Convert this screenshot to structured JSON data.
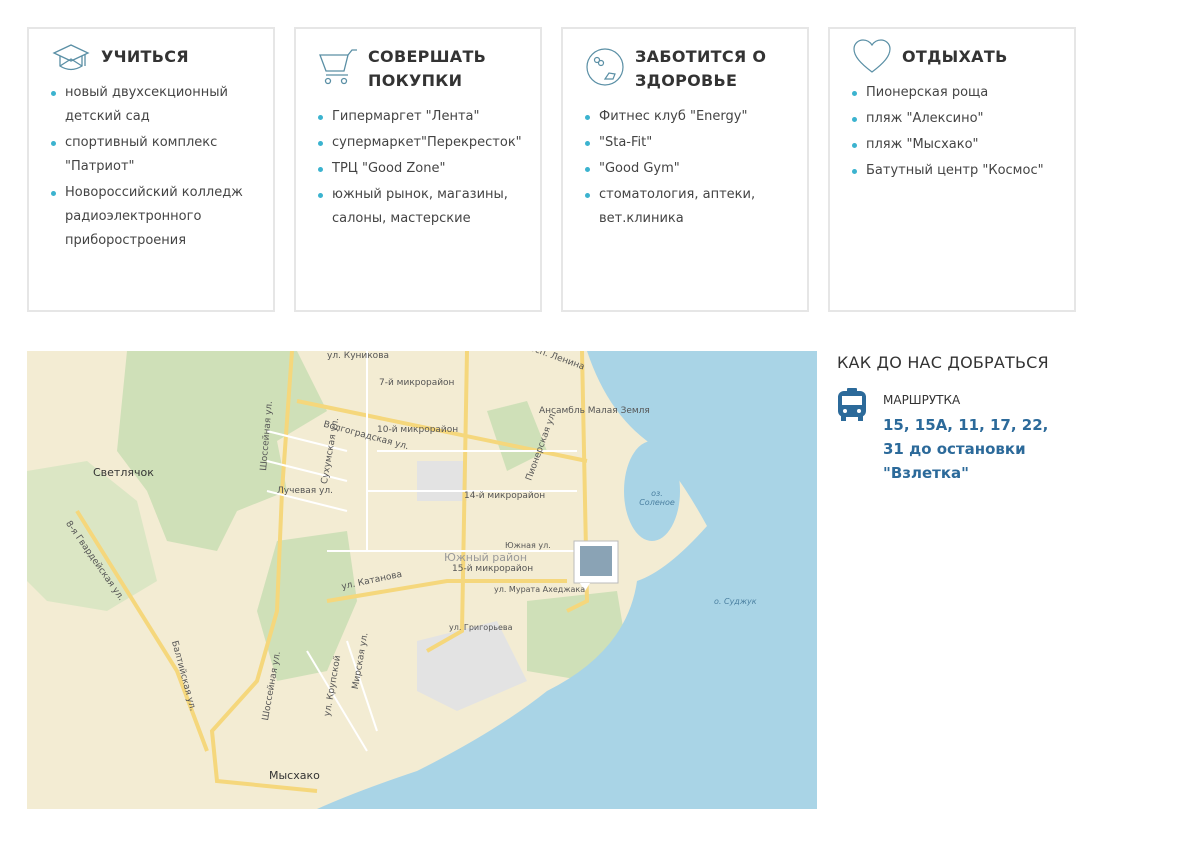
{
  "cards": [
    {
      "title": "УЧИТЬСЯ",
      "icon": "graduation-cap-icon",
      "items": [
        "новый двухсекционный детский сад",
        "спортивный комплекс \"Патриот\"",
        "Новороссийский колледж радиоэлектронного приборостроения"
      ]
    },
    {
      "title": "СОВЕРШАТЬ ПОКУПКИ",
      "icon": "shopping-cart-icon",
      "items": [
        "Гипермаргет \"Лента\"",
        "супермаркет\"Перекресток\"",
        "ТРЦ \"Good Zone\"",
        "южный рынок, магазины, салоны, мастерские"
      ]
    },
    {
      "title": "ЗАБОТИТСЯ О ЗДОРОВЬЕ",
      "icon": "health-icon",
      "items": [
        "Фитнес клуб \"Energy\"",
        "\"Sta-Fit\"",
        "\"Good Gym\"",
        "стоматология, аптеки, вет.клиника"
      ]
    },
    {
      "title": "ОТДЫХАТЬ",
      "icon": "heart-icon",
      "items": [
        "Пионерская роща",
        "пляж \"Алексино\"",
        "пляж \"Мысхако\"",
        "Батутный центр \"Космос\""
      ]
    }
  ],
  "map": {
    "labels": {
      "kunikova": "ул. Куникова",
      "lenina": "просп. Ленина",
      "mr7": "7-й микрорайон",
      "mr10": "10-й микрорайон",
      "volgograd": "Волгоградская ул.",
      "ansambl": "Ансамбль Малая Земля",
      "svetlyachok": "Светлячок",
      "shosseinaya1": "Шоссейная ул.",
      "sukhumi": "Сухумская ул.",
      "luchevaya": "Лучевая ул.",
      "pionerskaya": "Пионерская ул.",
      "mr14": "14-й микрорайон",
      "lake": "оз. Соленое",
      "gvardeiskaya": "8-я Гвардейская ул.",
      "yuzhny": "Южный район",
      "mr15": "15-й микрорайон",
      "yuzhnaya": "Южная ул.",
      "katanova": "ул. Катанова",
      "murata": "ул. Мурата Ахеджака",
      "sudzhuk": "о. Суджук",
      "grigoryeva": "ул. Григорьева",
      "baltiyskaya": "Балтийская ул.",
      "shosseinaya2": "Шоссейная ул.",
      "krupskoi": "ул. Крупской",
      "mirskaya": "Мирская ул.",
      "myskhako": "Мысхако"
    }
  },
  "directions": {
    "title": "КАК ДО НАС ДОБРАТЬСЯ",
    "transport_type": "МАРШРУТКА",
    "routes": "15, 15А, 11, 17, 22, 31 до остановки \"Взлетка\""
  }
}
